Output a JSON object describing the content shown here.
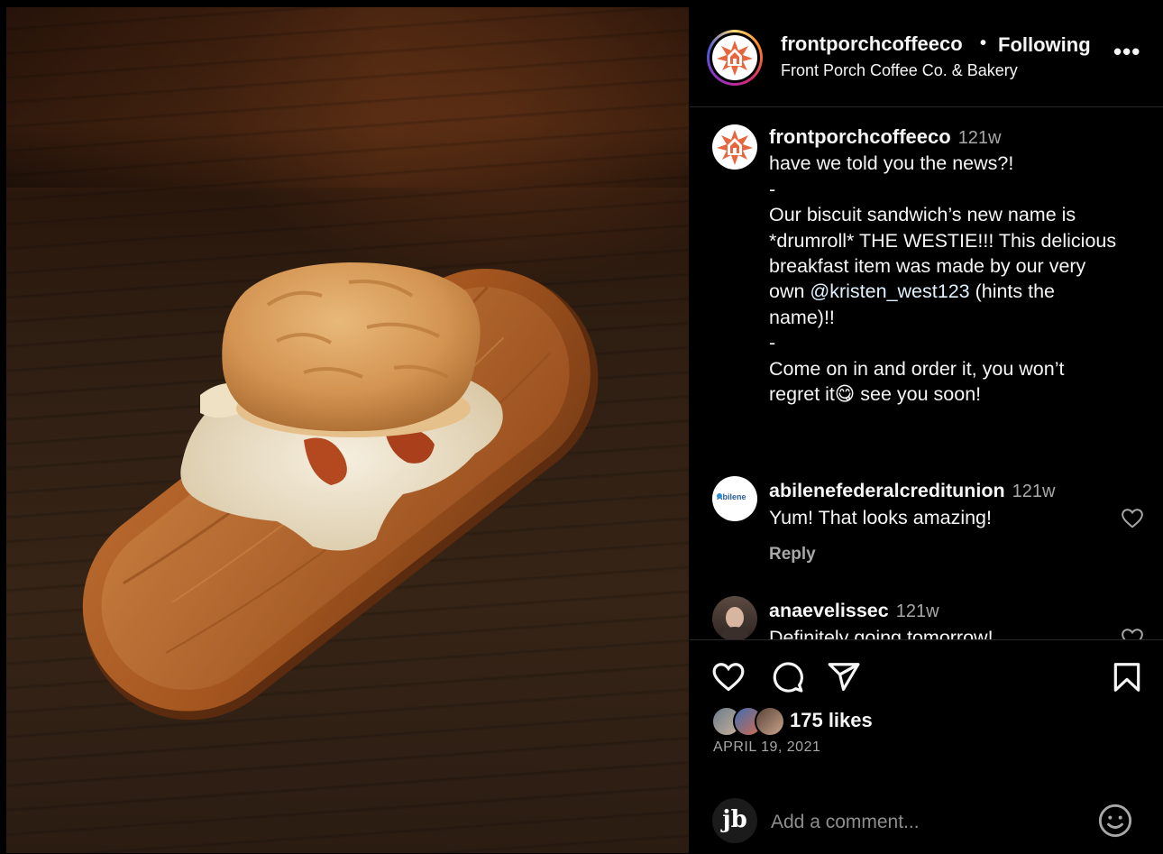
{
  "post": {
    "image_alt": "Biscuit sandwich with egg and bacon on a wooden tray",
    "author": {
      "username": "frontporchcoffeeco",
      "follow_status": "Following",
      "location": "Front Porch Coffee Co. & Bakery"
    },
    "caption": {
      "username": "frontporchcoffeeco",
      "time": "121w",
      "lines": [
        "have we told you the news?!",
        "-",
        "Our biscuit sandwich’s new name is",
        "*drumroll* THE WESTIE!!! This delicious",
        "breakfast item was made by our very"
      ],
      "line6_prefix": "own ",
      "mention": "@kristen_west123",
      "line6_suffix": " (hints the",
      "lines_after": [
        "name)!!",
        "-",
        "Come on in and order it, you won’t",
        "regret it😋 see you soon!"
      ]
    },
    "comments": [
      {
        "username": "abilenefederalcreditunion",
        "time": "121w",
        "text": "Yum! That looks amazing!",
        "reply_label": "Reply",
        "avatar_text": "Abilene"
      },
      {
        "username": "anaevelissec",
        "time": "121w",
        "text": "Definitely going tomorrow!"
      }
    ],
    "likes": "175 likes",
    "date": "APRIL 19, 2021"
  },
  "add_comment": {
    "placeholder": "Add a comment...",
    "avatar_text": "jb"
  },
  "icons": {
    "more": "more-options-icon",
    "like": "heart-icon",
    "comment": "comment-icon",
    "share": "share-icon",
    "save": "bookmark-icon",
    "emoji": "emoji-icon"
  },
  "colors": {
    "background": "#000000",
    "text": "#f5f5f5",
    "muted": "#a8a8a8",
    "divider": "#262626",
    "brand_orange": "#e8663d"
  }
}
